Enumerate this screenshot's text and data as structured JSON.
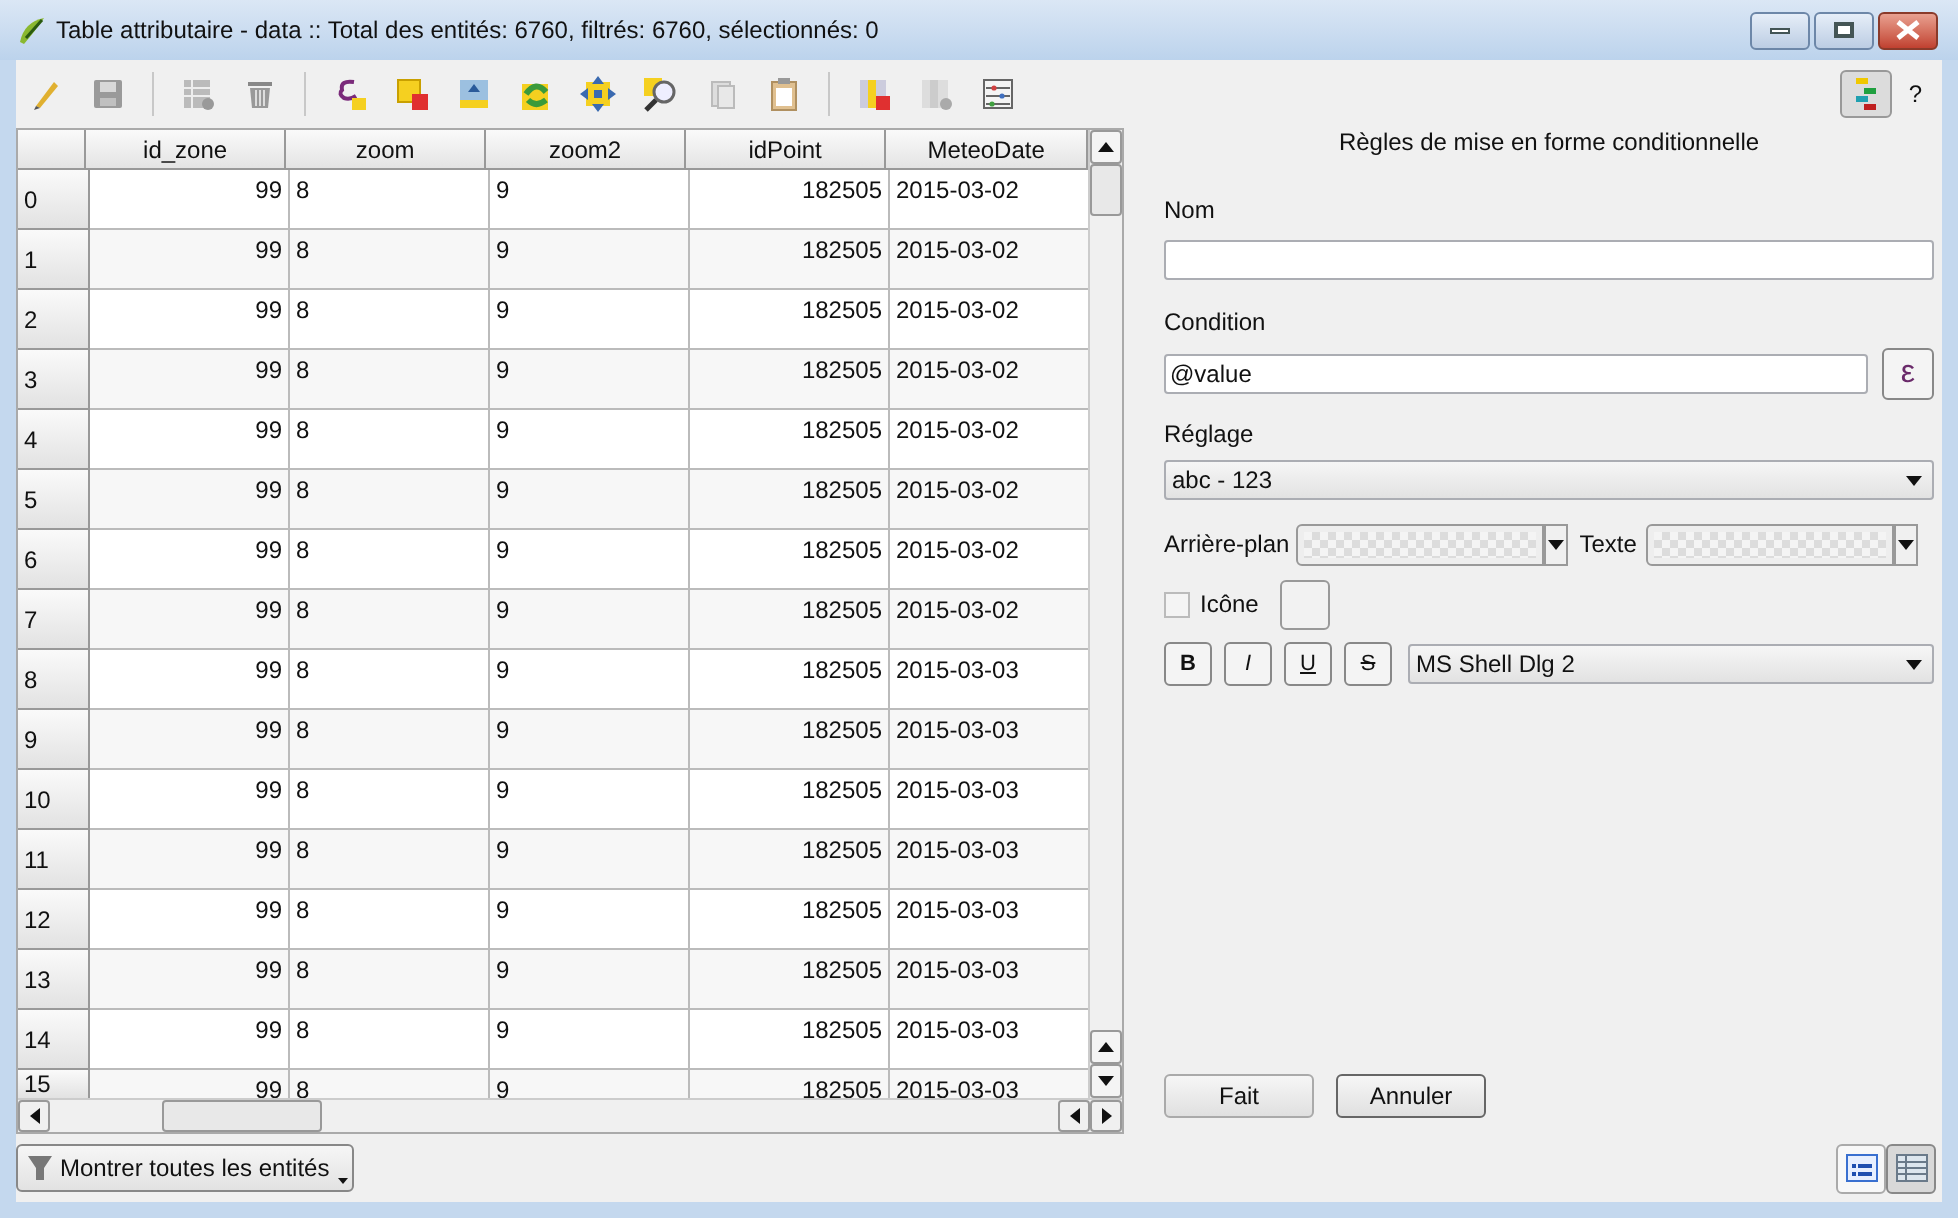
{
  "window": {
    "title": "Table attributaire - data :: Total des entités: 6760, filtrés: 6760, sélectionnés: 0"
  },
  "conditional_formatting_toggle": {
    "selected": true
  },
  "help": "?",
  "table": {
    "columns": [
      "id_zone",
      "zoom",
      "zoom2",
      "idPoint",
      "MeteoDate"
    ],
    "rows": [
      {
        "label": "0",
        "cells": [
          "99",
          "8",
          "9",
          "182505",
          "2015-03-02"
        ]
      },
      {
        "label": "1",
        "cells": [
          "99",
          "8",
          "9",
          "182505",
          "2015-03-02"
        ]
      },
      {
        "label": "2",
        "cells": [
          "99",
          "8",
          "9",
          "182505",
          "2015-03-02"
        ]
      },
      {
        "label": "3",
        "cells": [
          "99",
          "8",
          "9",
          "182505",
          "2015-03-02"
        ]
      },
      {
        "label": "4",
        "cells": [
          "99",
          "8",
          "9",
          "182505",
          "2015-03-02"
        ]
      },
      {
        "label": "5",
        "cells": [
          "99",
          "8",
          "9",
          "182505",
          "2015-03-02"
        ]
      },
      {
        "label": "6",
        "cells": [
          "99",
          "8",
          "9",
          "182505",
          "2015-03-02"
        ]
      },
      {
        "label": "7",
        "cells": [
          "99",
          "8",
          "9",
          "182505",
          "2015-03-02"
        ]
      },
      {
        "label": "8",
        "cells": [
          "99",
          "8",
          "9",
          "182505",
          "2015-03-03"
        ]
      },
      {
        "label": "9",
        "cells": [
          "99",
          "8",
          "9",
          "182505",
          "2015-03-03"
        ]
      },
      {
        "label": "10",
        "cells": [
          "99",
          "8",
          "9",
          "182505",
          "2015-03-03"
        ]
      },
      {
        "label": "11",
        "cells": [
          "99",
          "8",
          "9",
          "182505",
          "2015-03-03"
        ]
      },
      {
        "label": "12",
        "cells": [
          "99",
          "8",
          "9",
          "182505",
          "2015-03-03"
        ]
      },
      {
        "label": "13",
        "cells": [
          "99",
          "8",
          "9",
          "182505",
          "2015-03-03"
        ]
      },
      {
        "label": "14",
        "cells": [
          "99",
          "8",
          "9",
          "182505",
          "2015-03-03"
        ]
      },
      {
        "label": "15",
        "cells": [
          "99",
          "8",
          "9",
          "182505",
          "2015-03-03"
        ]
      }
    ]
  },
  "rule_panel": {
    "title": "Règles de mise en forme conditionnelle",
    "name_label": "Nom",
    "condition_label": "Condition",
    "condition_value": "@value",
    "expression_button": "ε",
    "preset_label": "Réglage",
    "preset_value": "abc - 123",
    "background_label": "Arrière-plan",
    "text_label": "Texte",
    "icon": {
      "label": "Icône",
      "checked": false
    },
    "style_buttons": [
      {
        "label": "B",
        "kind": "bold"
      },
      {
        "label": "I",
        "kind": "italic"
      },
      {
        "label": "U",
        "kind": "underline"
      },
      {
        "label": "S",
        "kind": "strike"
      }
    ],
    "font": "MS Shell Dlg 2",
    "buttons": [
      "Fait",
      "Annuler"
    ]
  },
  "filter_button": "Montrer toutes les entités",
  "view_switch": [
    {
      "kind": "form",
      "selected": false
    },
    {
      "kind": "table",
      "selected": true
    }
  ]
}
